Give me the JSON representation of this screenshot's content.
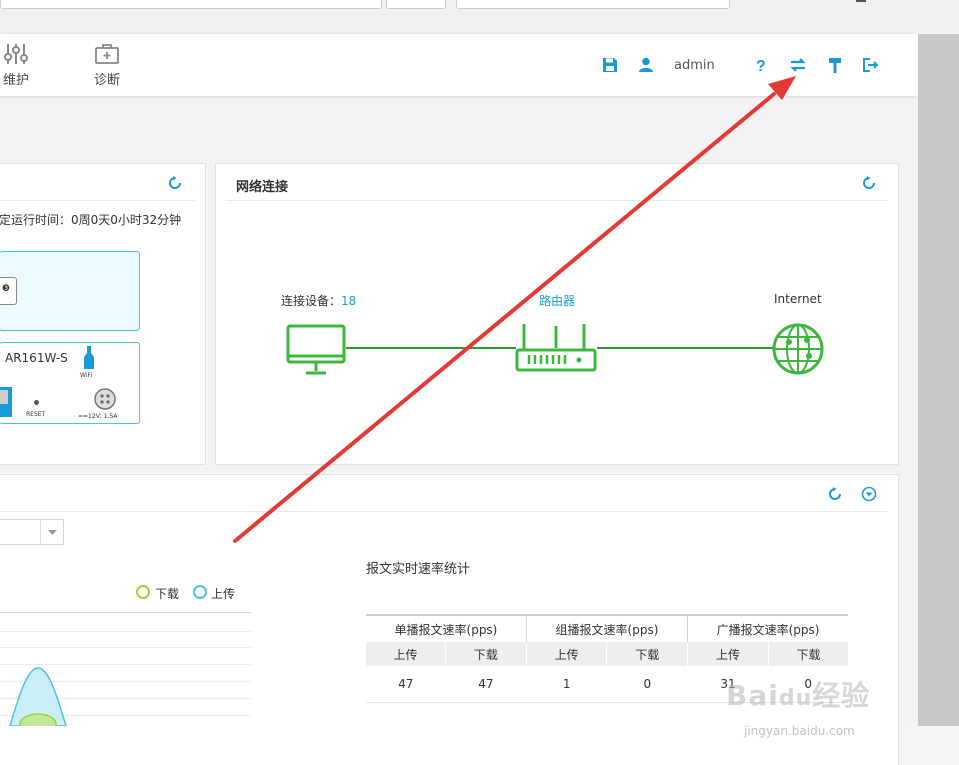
{
  "nav": [
    {
      "label": "维护",
      "icon": "sliders-icon"
    },
    {
      "label": "诊断",
      "icon": "medical-kit-icon"
    }
  ],
  "toolbar": {
    "user": "admin",
    "icons": [
      "save-icon",
      "user-icon",
      "help-icon",
      "switch-icon",
      "hammer-icon",
      "logout-icon"
    ]
  },
  "device_panel": {
    "uptime": "定运行时间：0周0天0小时32分钟",
    "model": "AR161W-S",
    "wifi": "WiFi",
    "reset": "RESET",
    "power": "==12V; 1.5A"
  },
  "network_panel": {
    "title": "网络连接",
    "devices_label": "连接设备：",
    "devices_count": "18",
    "router_label": "路由器",
    "internet_label": "Internet"
  },
  "traffic_panel": {
    "legend_download": "下载",
    "legend_upload": "上传",
    "stats_title": "报文实时速率统计",
    "columns": [
      "单播报文速率(pps)",
      "组播报文速率(pps)",
      "广播报文速率(pps)"
    ],
    "sub_columns": [
      "上传",
      "下载",
      "上传",
      "下载",
      "上传",
      "下载"
    ],
    "values": [
      "47",
      "47",
      "1",
      "0",
      "31",
      "0"
    ]
  },
  "colors": {
    "accent": "#1a9bd7",
    "green": "#3cb73c",
    "cyan": "#4fc3d6",
    "arrow": "#e53935"
  }
}
